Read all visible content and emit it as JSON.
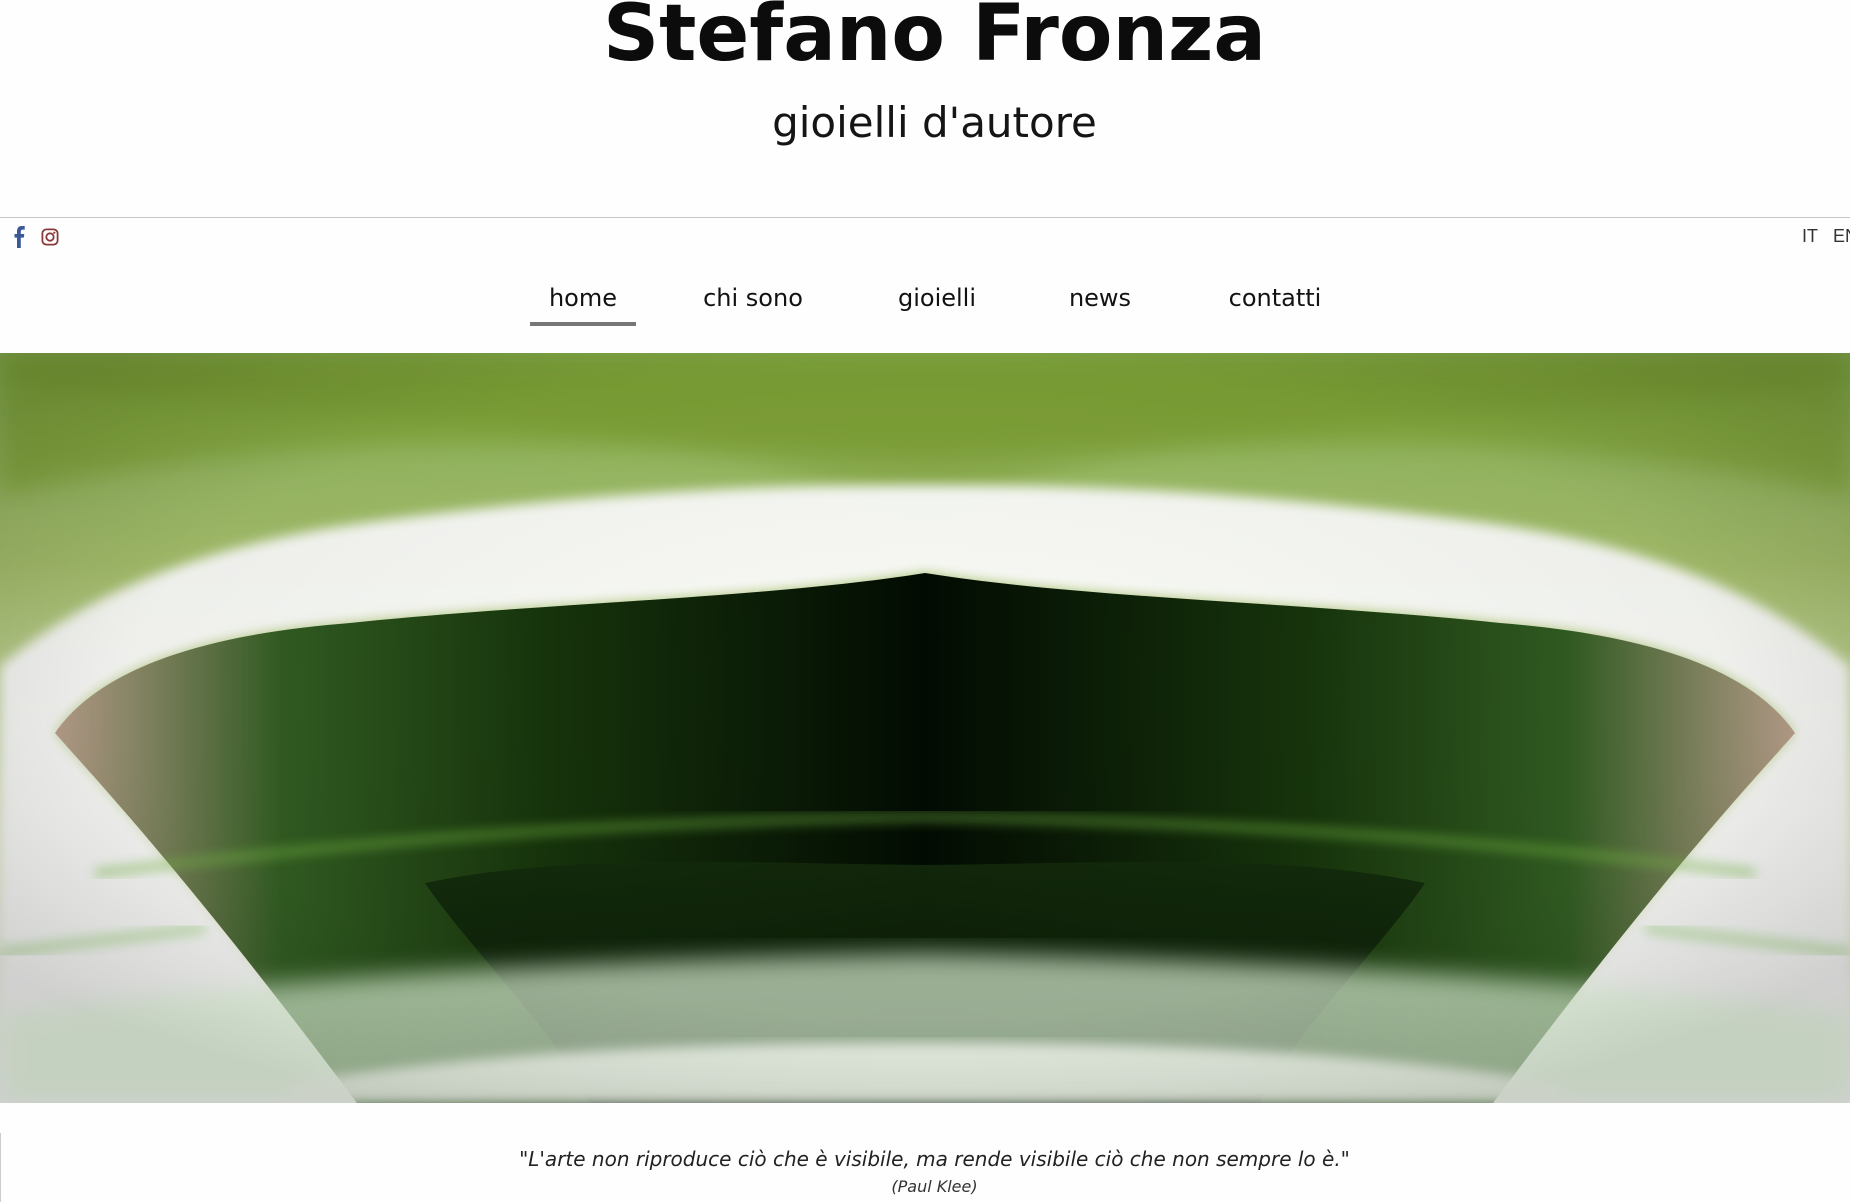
{
  "header": {
    "title": "Stefano Fronza",
    "subtitle": "gioielli d'autore"
  },
  "social": {
    "icons": [
      "facebook-icon",
      "instagram-icon"
    ],
    "facebook_color": "#3b5998",
    "instagram_color": "#8a3a3a"
  },
  "language": {
    "options": [
      "IT",
      "EN"
    ],
    "active": "IT"
  },
  "nav": {
    "items": [
      {
        "label": "home",
        "active": true
      },
      {
        "label": "chi sono",
        "active": false
      },
      {
        "label": "gioielli",
        "active": false
      },
      {
        "label": "news",
        "active": false
      },
      {
        "label": "contatti",
        "active": false
      }
    ],
    "underline_color": "#777777"
  },
  "hero": {
    "image": "abstract-green-light-streak-photo",
    "dominant_colors": [
      "#8cb249",
      "#fbfdf0",
      "#062303",
      "#c7a999"
    ]
  },
  "quote": {
    "text": "\"L'arte non riproduce ciò che è visibile, ma rende visibile ciò che non sempre lo è.\"",
    "author": "(Paul Klee)"
  }
}
